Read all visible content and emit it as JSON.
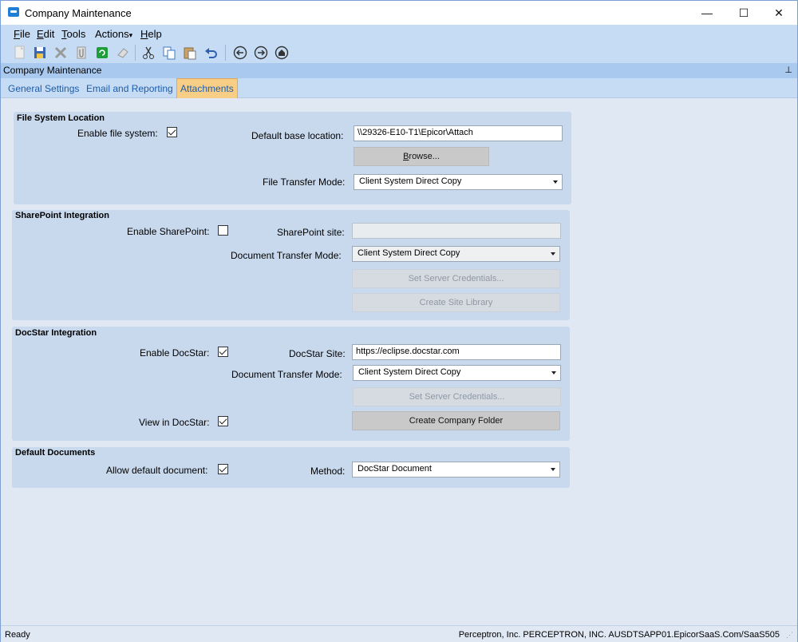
{
  "window": {
    "title": "Company Maintenance",
    "controls": {
      "minimize": "—",
      "maximize": "☐",
      "close": "✕"
    }
  },
  "menu": {
    "items": [
      {
        "prefix": "",
        "key": "F",
        "rest": "ile"
      },
      {
        "prefix": "",
        "key": "E",
        "rest": "dit"
      },
      {
        "prefix": "",
        "key": "T",
        "rest": "ools"
      },
      {
        "prefix": "Actions",
        "key": "",
        "rest": ""
      },
      {
        "prefix": "",
        "key": "H",
        "rest": "elp"
      }
    ],
    "actions_caret": "▾"
  },
  "toolbar": {
    "icons": [
      "new-icon",
      "save-icon",
      "delete-icon",
      "attachment-icon",
      "refresh-icon",
      "clear-icon",
      "cut-icon",
      "copy-icon",
      "paste-icon",
      "undo-icon",
      "back-icon",
      "forward-icon",
      "home-icon"
    ]
  },
  "panel": {
    "title": "Company Maintenance",
    "pin": "⊥"
  },
  "tabs": [
    {
      "label": "General Settings",
      "active": false
    },
    {
      "label": "Email and Reporting",
      "active": false
    },
    {
      "label": "Attachments",
      "active": true
    }
  ],
  "file_system": {
    "title": "File System Location",
    "enable_label": "Enable file system:",
    "enabled": true,
    "base_location_label": "Default base location:",
    "base_location_value": "\\\\29326-E10-T1\\Epicor\\Attach",
    "browse_label_key": "B",
    "browse_label_rest": "rowse...",
    "transfer_mode_label": "File Transfer Mode:",
    "transfer_mode_value": "Client System Direct Copy"
  },
  "sharepoint": {
    "title": "SharePoint Integration",
    "enable_label": "Enable SharePoint:",
    "enabled": false,
    "site_label": "SharePoint site:",
    "site_value": "",
    "transfer_mode_label": "Document Transfer Mode:",
    "transfer_mode_value": "Client System Direct Copy",
    "credentials_label": "Set  Server Credentials...",
    "create_library_label": "Create Site Library"
  },
  "docstar": {
    "title": "DocStar Integration",
    "enable_label": "Enable DocStar:",
    "enabled": true,
    "site_label": "DocStar Site:",
    "site_value": "https://eclipse.docstar.com",
    "transfer_mode_label": "Document Transfer Mode:",
    "transfer_mode_value": "Client System Direct Copy",
    "credentials_label": "Set Server Credentials...",
    "view_label": "View in DocStar:",
    "view_enabled": true,
    "create_folder_label": "Create Company Folder"
  },
  "default_documents": {
    "title": "Default Documents",
    "allow_label": "Allow default document:",
    "allow_enabled": true,
    "method_label": "Method:",
    "method_value": "DocStar Document"
  },
  "status": {
    "left": "Ready",
    "right": "Perceptron, Inc.  PERCEPTRON, INC.   AUSDTSAPP01.EpicorSaaS.Com/SaaS505"
  }
}
